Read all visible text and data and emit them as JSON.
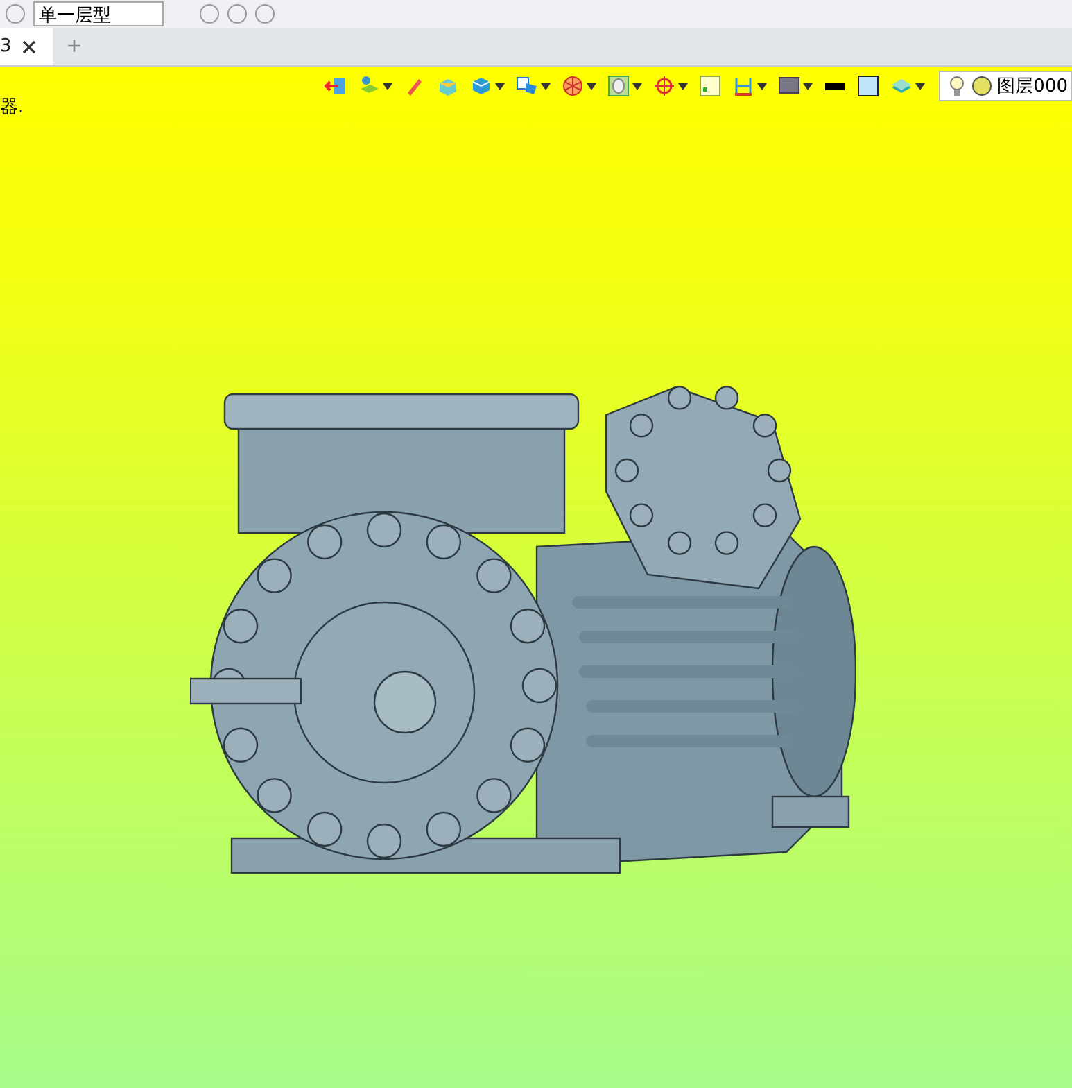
{
  "top_toolbar": {
    "style_dropdown": {
      "value": "单一层型"
    }
  },
  "tabs": [
    {
      "label": "3",
      "selected": true
    }
  ],
  "new_tab": "+",
  "viewport": {
    "message": "器.",
    "view_toolbar": [
      {
        "dropdown": false
      },
      {
        "dropdown": true
      },
      {
        "dropdown": false
      },
      {
        "dropdown": false
      },
      {
        "dropdown": true
      },
      {
        "dropdown": true
      },
      {
        "dropdown": true
      },
      {
        "dropdown": true
      },
      {
        "dropdown": true
      },
      {
        "dropdown": false
      },
      {
        "dropdown": true
      },
      {
        "dropdown": true
      },
      {
        "dropdown": false
      },
      {
        "dropdown": false
      },
      {
        "dropdown": true
      }
    ],
    "layer_field": {
      "value": "图层000"
    }
  }
}
